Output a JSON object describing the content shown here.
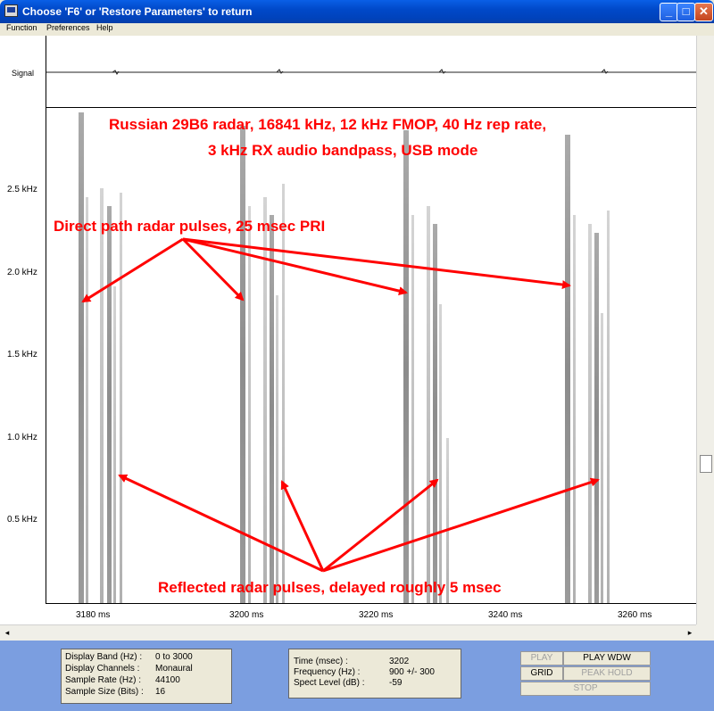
{
  "window": {
    "title": "Choose 'F6' or 'Restore Parameters' to return"
  },
  "menu": [
    "Function",
    "Preferences",
    "Help"
  ],
  "signal_label": "Signal",
  "y_axis": [
    "2.5 kHz",
    "2.0 kHz",
    "1.5 kHz",
    "1.0 kHz",
    "0.5 kHz"
  ],
  "x_axis": [
    "3180 ms",
    "3200 ms",
    "3220 ms",
    "3240 ms",
    "3260 ms"
  ],
  "annotations": {
    "title_line1": "Russian 29B6 radar, 16841 kHz, 12 kHz FMOP, 40 Hz rep rate,",
    "title_line2": "3 kHz RX audio bandpass, USB mode",
    "direct": "Direct path radar pulses, 25 msec PRI",
    "reflected": "Reflected radar pulses, delayed roughly 5 msec"
  },
  "info_left": {
    "rows": [
      {
        "label": "Display Band (Hz) :",
        "value": "0 to 3000"
      },
      {
        "label": "Display Channels :",
        "value": "Monaural"
      },
      {
        "label": "Sample Rate (Hz) :",
        "value": "44100"
      },
      {
        "label": "Sample Size (Bits) :",
        "value": "16"
      }
    ]
  },
  "info_right": {
    "rows": [
      {
        "label": "Time (msec) :",
        "value": "3202"
      },
      {
        "label": "Frequency (Hz) :",
        "value": "900  +/- 300"
      },
      {
        "label": "Spect Level (dB) :",
        "value": "-59"
      }
    ]
  },
  "buttons": {
    "play": "PLAY",
    "play_wdw": "PLAY WDW",
    "grid": "GRID",
    "peak_hold": "PEAK HOLD",
    "stop": "STOP"
  },
  "colors": {
    "annotation": "#ff0000",
    "bottom_panel": "#7b9ee0",
    "title_bar": "#0049c9"
  }
}
